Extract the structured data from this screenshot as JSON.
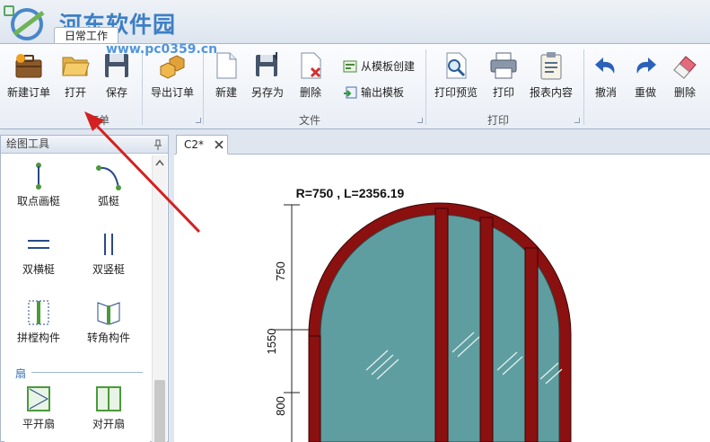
{
  "watermark": {
    "brand": "河东软件园",
    "url": "www.pc0359.cn"
  },
  "ribbon": {
    "tab_label": "日常工作",
    "groups": {
      "order_label": "订单",
      "file_label": "文件",
      "print_label": "打印"
    },
    "buttons": {
      "new_order": "新建订单",
      "open": "打开",
      "save": "保存",
      "export_order": "导出订单",
      "new": "新建",
      "save_as": "另存为",
      "delete": "删除",
      "from_template": "从模板创建",
      "output_template": "输出模板",
      "print_preview": "打印预览",
      "print": "打印",
      "report_content": "报表内容",
      "undo": "撤消",
      "redo": "重做",
      "erase": "删除"
    }
  },
  "side_panel": {
    "title": "绘图工具",
    "tools": {
      "point_frame": "取点画梃",
      "arc_frame": "弧梃",
      "double_horizontal": "双横梃",
      "double_vertical": "双竖梃",
      "joint_member": "拼樘构件",
      "corner_member": "转角构件",
      "section_sash": "扇",
      "casement": "平开扇",
      "double_casement": "对开扇"
    }
  },
  "document": {
    "tab_label": "C2*",
    "drawing": {
      "arc_caption": "R=750 , L=2356.19",
      "dim_total": "1550",
      "dim_top": "750",
      "dim_bottom": "800"
    }
  },
  "colors": {
    "frame": "#8b1010",
    "glass": "#5f9ea0",
    "arrow": "#d42020",
    "watermark": "#2f76c2"
  }
}
